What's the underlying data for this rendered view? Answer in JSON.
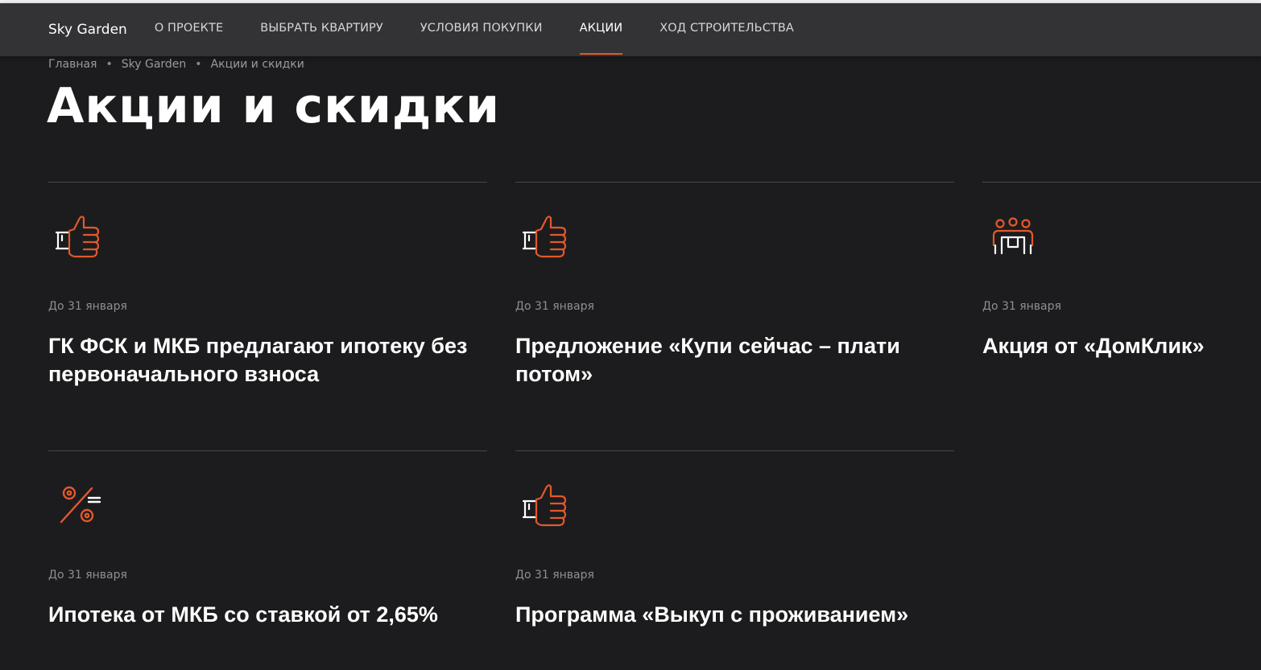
{
  "header": {
    "brand": "Sky Garden",
    "nav": [
      {
        "label": "О ПРОЕКТЕ"
      },
      {
        "label": "ВЫБРАТЬ КВАРТИРУ"
      },
      {
        "label": "УСЛОВИЯ ПОКУПКИ"
      },
      {
        "label": "АКЦИИ",
        "active": true
      },
      {
        "label": "ХОД СТРОИТЕЛЬСТВА"
      }
    ]
  },
  "breadcrumb": {
    "items": [
      "Главная",
      "Sky Garden",
      "Акции и скидки"
    ],
    "separator": "•"
  },
  "page": {
    "title": "Акции и скидки"
  },
  "colors": {
    "accent": "#e2592a",
    "background": "#1c1c1e",
    "navbar": "#333235"
  },
  "promos": [
    {
      "icon": "thumbs-up-icon",
      "date": "До 31 января",
      "title": "ГК ФСК и МКБ предлагают ипотеку без первоначального взноса"
    },
    {
      "icon": "thumbs-up-icon",
      "date": "До 31 января",
      "title": "Предложение «Купи сейчас – плати потом»"
    },
    {
      "icon": "people-at-table-icon",
      "date": "До 31 января",
      "title": "Акция от «ДомКлик»"
    },
    {
      "icon": "percent-icon",
      "date": "До 31 января",
      "title": "Ипотека от МКБ со ставкой от 2,65%"
    },
    {
      "icon": "thumbs-up-icon",
      "date": "До 31 января",
      "title": "Программа «Выкуп с проживанием»"
    }
  ]
}
